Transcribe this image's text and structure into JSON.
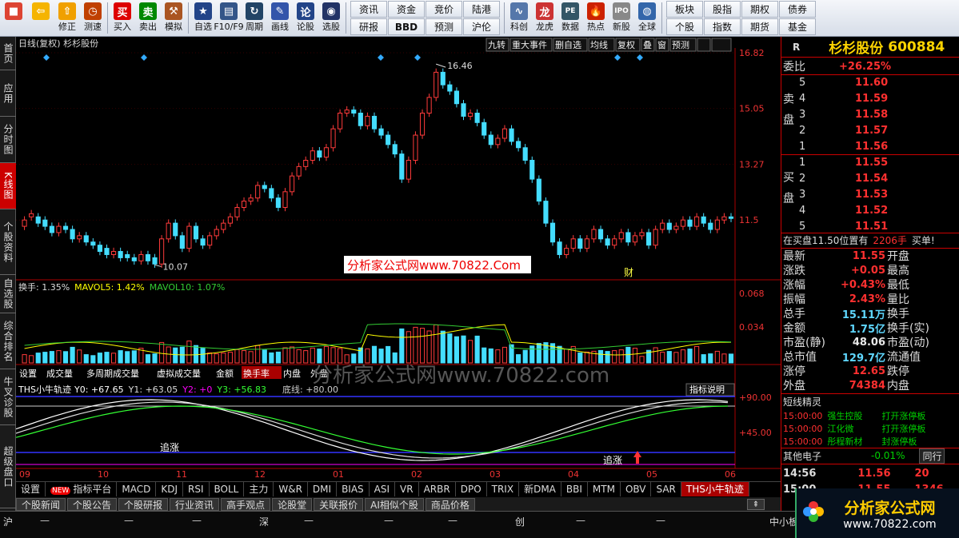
{
  "toolbar": {
    "buttons": [
      {
        "label": "",
        "icon": "app-icon",
        "color": "#d43"
      },
      {
        "label": "",
        "icon": "back-arrow-icon",
        "color": "#f5b400"
      },
      {
        "label": "修正",
        "icon": "up-arrow-icon",
        "color": "#f0a000"
      },
      {
        "label": "测速",
        "icon": "clock-icon",
        "color": "#c04000"
      },
      {
        "label": "买入",
        "icon": "buy-icon",
        "color": "#d00"
      },
      {
        "label": "卖出",
        "icon": "sell-icon",
        "color": "#080"
      },
      {
        "label": "模拟",
        "icon": "hammer-icon",
        "color": "#a52"
      },
      {
        "label": "自选",
        "icon": "star-icon",
        "color": "#248"
      },
      {
        "label": "F10/F9",
        "icon": "f10-icon",
        "color": "#358"
      },
      {
        "label": "周期",
        "icon": "cycle-icon",
        "color": "#246"
      },
      {
        "label": "画线",
        "icon": "pen-icon",
        "color": "#35a"
      },
      {
        "label": "论股",
        "icon": "talk-icon",
        "color": "#248"
      },
      {
        "label": "选股",
        "icon": "select-icon",
        "color": "#236"
      }
    ],
    "grid1": [
      "资讯",
      "资金",
      "竞价",
      "陆港",
      "研报",
      "BBD",
      "预测",
      "沪伦"
    ],
    "buttons2": [
      {
        "label": "科创",
        "icon": "sci-icon",
        "color": "#5577aa"
      },
      {
        "label": "龙虎",
        "icon": "dragon-icon",
        "color": "#c33"
      },
      {
        "label": "数据",
        "icon": "pe-icon",
        "color": "#356"
      },
      {
        "label": "热点",
        "icon": "hot-icon",
        "color": "#c20"
      },
      {
        "label": "新股",
        "icon": "ipo-icon",
        "color": "#888"
      },
      {
        "label": "全球",
        "icon": "globe-icon",
        "color": "#36a"
      }
    ],
    "grid2": [
      "板块",
      "股指",
      "期权",
      "债券",
      "个股",
      "指数",
      "期货",
      "基金"
    ]
  },
  "leftnav": [
    "首页",
    "应用",
    "分时图",
    "K线图",
    "个股资料",
    "自选股",
    "综合排名",
    "牛叉诊股",
    "超级盘口"
  ],
  "chart_data": {
    "type": "candlestick",
    "title": "日线(复权) 杉杉股份",
    "y_ticks": [
      16.82,
      15.05,
      13.27,
      11.5
    ],
    "ylim": [
      9.7,
      16.82
    ],
    "high_label": "16.46",
    "low_label": "10.07",
    "x_labels": [
      "09",
      "10",
      "11",
      "12",
      "01",
      "02",
      "03",
      "04",
      "05",
      "06"
    ],
    "candles": [
      [
        11.3,
        11.5
      ],
      [
        11.6,
        11.7
      ],
      [
        11.6,
        11.4
      ],
      [
        11.5,
        11.3
      ],
      [
        11.3,
        11.1
      ],
      [
        11.1,
        11.3
      ],
      [
        11.3,
        11.2
      ],
      [
        11.2,
        10.9
      ],
      [
        10.9,
        11
      ],
      [
        11,
        10.8
      ],
      [
        10.8,
        10.7
      ],
      [
        10.7,
        10.5
      ],
      [
        10.6,
        10.4
      ],
      [
        10.4,
        10.5
      ],
      [
        10.5,
        10.3
      ],
      [
        10.4,
        10.3
      ],
      [
        10.3,
        10.2
      ],
      [
        10.2,
        10.4
      ],
      [
        10.4,
        10.2
      ],
      [
        10.3,
        10.1
      ],
      [
        10.1,
        10.9
      ],
      [
        10.9,
        11.4
      ],
      [
        11.4,
        11
      ],
      [
        11,
        10.6
      ],
      [
        10.6,
        11.3
      ],
      [
        11.3,
        10.9
      ],
      [
        10.9,
        10.7
      ],
      [
        10.7,
        11
      ],
      [
        11,
        11.2
      ],
      [
        11.2,
        11.4
      ],
      [
        11.4,
        11.6
      ],
      [
        11.6,
        11.9
      ],
      [
        11.9,
        12.1
      ],
      [
        12.1,
        12.2
      ],
      [
        12.2,
        12.6
      ],
      [
        12.6,
        12.5
      ],
      [
        12.5,
        12.2
      ],
      [
        12.2,
        11.9
      ],
      [
        11.9,
        12.4
      ],
      [
        12.4,
        12.9
      ],
      [
        12.9,
        13.2
      ],
      [
        13.2,
        13.4
      ],
      [
        13.4,
        13.7
      ],
      [
        13.7,
        13.5
      ],
      [
        13.5,
        13.8
      ],
      [
        13.8,
        14.4
      ],
      [
        14.4,
        14.9
      ],
      [
        14.9,
        15
      ],
      [
        15,
        14.9
      ],
      [
        14.9,
        14.5
      ],
      [
        14.5,
        14.8
      ],
      [
        14.8,
        14.4
      ],
      [
        14.4,
        14.2
      ],
      [
        14.2,
        13.9
      ],
      [
        13.9,
        13.6
      ],
      [
        13.6,
        12.8
      ],
      [
        12.8,
        13.4
      ],
      [
        13.4,
        14.2
      ],
      [
        14.2,
        14.9
      ],
      [
        14.9,
        15.4
      ],
      [
        15.4,
        16.2
      ],
      [
        16.2,
        15.8
      ],
      [
        15.8,
        15.6
      ],
      [
        15.6,
        15.2
      ],
      [
        15.2,
        14.8
      ],
      [
        14.8,
        14.9
      ],
      [
        14.9,
        14.6
      ],
      [
        14.6,
        14.2
      ],
      [
        14.2,
        13.9
      ],
      [
        13.9,
        14.1
      ],
      [
        14.1,
        14.4
      ],
      [
        14.4,
        14
      ],
      [
        14,
        13.8
      ],
      [
        13.8,
        13.4
      ],
      [
        13.4,
        12.8
      ],
      [
        12.8,
        12.1
      ],
      [
        12.1,
        11.4
      ],
      [
        11.4,
        10.8
      ],
      [
        10.8,
        10.4
      ],
      [
        10.4,
        10.6
      ],
      [
        10.6,
        10.9
      ],
      [
        10.9,
        10.6
      ],
      [
        10.6,
        10.9
      ],
      [
        10.9,
        11.2
      ],
      [
        11.2,
        10.9
      ],
      [
        10.9,
        10.7
      ],
      [
        10.7,
        10.9
      ],
      [
        10.9,
        11.1
      ],
      [
        11.1,
        10.8
      ],
      [
        10.8,
        11
      ],
      [
        11,
        11.1
      ],
      [
        11.1,
        10.7
      ],
      [
        10.7,
        11.2
      ],
      [
        11.2,
        11.4
      ],
      [
        11.4,
        11.2
      ],
      [
        11.2,
        11.3
      ],
      [
        11.3,
        11.5
      ],
      [
        11.5,
        11.3
      ],
      [
        11.3,
        11.6
      ],
      [
        11.6,
        11.4
      ],
      [
        11.4,
        11.2
      ],
      [
        11.2,
        11.5
      ],
      [
        11.5,
        11.6
      ],
      [
        11.6,
        11.55
      ]
    ],
    "volume": {
      "label": "换手: 1.35%",
      "mavol5": "MAVOL5: 1.42%",
      "mavol10": "MAVOL10: 1.07%",
      "ticks": [
        "0.068",
        "0.034"
      ]
    },
    "indicator": {
      "name": "THS小牛轨迹",
      "y0": "Y0: +67.65",
      "y1": "Y1: +63.05",
      "y2": "Y2: +0",
      "y3": "Y3: +56.83",
      "extra": "底线: +80.00",
      "explain": "指标说明",
      "ticks": [
        "+90.00",
        "+45.00"
      ],
      "signal1": "追涨",
      "signal2": "追涨"
    }
  },
  "chart_toolbar": [
    "九转",
    "重大事件",
    "删自选",
    "均线",
    "复权",
    "叠",
    "窗",
    "预测"
  ],
  "subtabs": [
    "设置",
    "成交量",
    "多周期成交量",
    "虚拟成交量",
    "金额",
    "换手率",
    "内盘",
    "外盘"
  ],
  "bottom_tabs": [
    "设置",
    "指标平台",
    "MACD",
    "KDJ",
    "RSI",
    "BOLL",
    "主力",
    "W&R",
    "DMI",
    "BIAS",
    "ASI",
    "VR",
    "ARBR",
    "DPO",
    "TRIX",
    "新DMA",
    "BBI",
    "MTM",
    "OBV",
    "SAR",
    "THS小牛轨迹"
  ],
  "new_badge": "NEW",
  "news_tabs": [
    "个股新闻",
    "个股公告",
    "个股研报",
    "行业资讯",
    "高手观点",
    "论股堂",
    "关联报价",
    "AI相似个股",
    "商品价格"
  ],
  "watermark": "分析家公式网www.70822.Com",
  "watermark2": "分析家公式网www.70822.com",
  "cai_label": "财",
  "quote": {
    "code_label": "R",
    "name": "杉杉股份",
    "code": "600884",
    "weibi": "委比",
    "weibi_val": "+26.25%",
    "sell_label": "卖盘",
    "buy_label": "买盘",
    "sell": [
      [
        "5",
        "11.60"
      ],
      [
        "4",
        "11.59"
      ],
      [
        "3",
        "11.58"
      ],
      [
        "2",
        "11.57"
      ],
      [
        "1",
        "11.56"
      ]
    ],
    "buy": [
      [
        "1",
        "11.55"
      ],
      [
        "2",
        "11.54"
      ],
      [
        "3",
        "11.53"
      ],
      [
        "4",
        "11.52"
      ],
      [
        "5",
        "11.51"
      ]
    ],
    "pending": "在买盘11.50位置有",
    "pending_amt": "2206手",
    "pending_tag": "买单!",
    "stats": [
      [
        "最新",
        "11.55",
        "开盘"
      ],
      [
        "涨跌",
        "+0.05",
        "最高"
      ],
      [
        "涨幅",
        "+0.43%",
        "最低"
      ],
      [
        "振幅",
        "2.43%",
        "量比"
      ],
      [
        "总手",
        "15.11万",
        "换手"
      ],
      [
        "金额",
        "1.75亿",
        "换手(实)"
      ],
      [
        "市盈(静)",
        "48.06",
        "市盈(动)"
      ],
      [
        "总市值",
        "129.7亿",
        "流通值"
      ],
      [
        "涨停",
        "12.65",
        "跌停"
      ],
      [
        "外盘",
        "74384",
        "内盘"
      ]
    ],
    "short_title": "短线精灵",
    "short": [
      [
        "15:00:00",
        "强生控股",
        "打开涨停板"
      ],
      [
        "15:00:00",
        "江化微",
        "打开涨停板"
      ],
      [
        "15:00:00",
        "彤程新材",
        "封涨停板"
      ]
    ],
    "sector": "其他电子",
    "sector_chg": "-0.01%",
    "sector_btn": "同行",
    "ticks": [
      [
        "14:56",
        "11.56",
        "20"
      ],
      [
        "15:00",
        "11.55",
        "1346"
      ]
    ]
  },
  "status": {
    "sh": "沪",
    "sz": "深",
    "cy": "创",
    "bj": "中小板",
    "dash": "—"
  },
  "logo": {
    "title": "分析家公式网",
    "url": "www.70822.com"
  }
}
